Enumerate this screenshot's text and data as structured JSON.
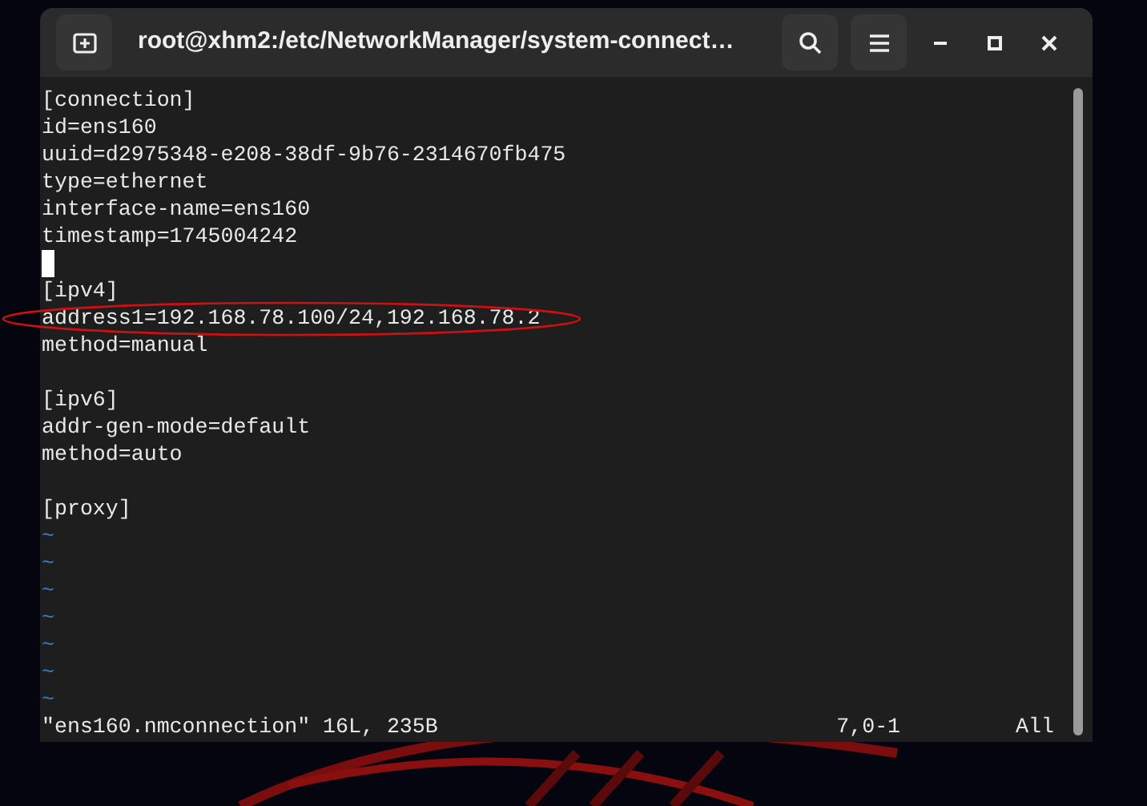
{
  "window": {
    "title": "root@xhm2:/etc/NetworkManager/system-connect…"
  },
  "editor": {
    "lines": [
      {
        "kind": "text",
        "text": "[connection]",
        "circled": false
      },
      {
        "kind": "text",
        "text": "id=ens160",
        "circled": false
      },
      {
        "kind": "text",
        "text": "uuid=d2975348-e208-38df-9b76-2314670fb475",
        "circled": false
      },
      {
        "kind": "text",
        "text": "type=ethernet",
        "circled": false
      },
      {
        "kind": "text",
        "text": "interface-name=ens160",
        "circled": false
      },
      {
        "kind": "text",
        "text": "timestamp=1745004242",
        "circled": false
      },
      {
        "kind": "cursor"
      },
      {
        "kind": "text",
        "text": "[ipv4]",
        "circled": false
      },
      {
        "kind": "text",
        "text": "address1=192.168.78.100/24,192.168.78.2",
        "circled": true
      },
      {
        "kind": "text",
        "text": "method=manual",
        "circled": false
      },
      {
        "kind": "empty"
      },
      {
        "kind": "text",
        "text": "[ipv6]",
        "circled": false
      },
      {
        "kind": "text",
        "text": "addr-gen-mode=default",
        "circled": false
      },
      {
        "kind": "text",
        "text": "method=auto",
        "circled": false
      },
      {
        "kind": "empty"
      },
      {
        "kind": "text",
        "text": "[proxy]",
        "circled": false
      }
    ],
    "tildes": [
      "~",
      "~",
      "~",
      "~",
      "~",
      "~",
      "~"
    ],
    "status": {
      "file": "\"ens160.nmconnection\" 16L, 235B",
      "position": "7,0-1",
      "scroll": "All"
    }
  }
}
